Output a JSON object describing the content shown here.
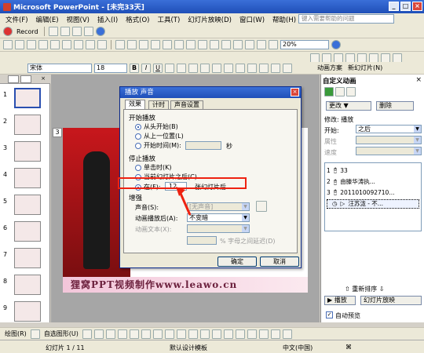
{
  "window": {
    "title": "Microsoft PowerPoint - [未完33天]"
  },
  "menu": {
    "items": [
      "文件(F)",
      "编辑(E)",
      "视图(V)",
      "插入(I)",
      "格式(O)",
      "工具(T)",
      "幻灯片放映(D)",
      "窗口(W)",
      "帮助(H)"
    ],
    "help_placeholder": "键入需要帮助的问题"
  },
  "toolbar1": {
    "record_label": "Record"
  },
  "toolbar2": {
    "zoom": "20%"
  },
  "toolbar3": {
    "font_name": "宋体",
    "font_size": "18",
    "animation_label": "动画方案",
    "new_slide_label": "新幻灯片(N)"
  },
  "dialog": {
    "title": "播放 声音",
    "tabs": [
      "效果",
      "计时",
      "声音设置"
    ],
    "start_group": "开始播放",
    "start_options": [
      "从头开始(B)",
      "从上一位置(L)",
      "开始时间(M):"
    ],
    "start_unit": "秒",
    "stop_group": "停止播放",
    "stop_options": [
      "单击时(K)",
      "当前幻灯片之后(C)",
      "在(F):"
    ],
    "stop_after_value": "12",
    "stop_after_unit": "张幻灯片后",
    "enhance_group": "增强",
    "sound_label": "声音(S):",
    "sound_value": "[无声音]",
    "after_anim_label": "动画播放后(A):",
    "after_anim_value": "不变暗",
    "anim_text_label": "动画文本(X):",
    "letter_delay_label": "% 字母之间延迟(D)",
    "ok_label": "确定",
    "cancel_label": "取消"
  },
  "slide": {
    "number": "3",
    "banner": "狸窝PPT视频制作www.leawo.cn"
  },
  "taskpane": {
    "title": "自定义动画",
    "change_label": "更改",
    "delete_label": "删除",
    "modify_label": "修改: 播放",
    "start_label": "开始:",
    "start_value": "之后",
    "property_label": "属性",
    "speed_label": "速度",
    "list": [
      {
        "num": "1",
        "text": "33"
      },
      {
        "num": "2",
        "text": "由滕华涛执..."
      },
      {
        "num": "3",
        "text": "2011010092710..."
      },
      {
        "num": "",
        "text": "汪苏泷 - 不..."
      }
    ],
    "reorder_label": "重新排序",
    "play_label": "播放",
    "slideshow_label": "幻灯片放映",
    "autopreview_label": "自动预览"
  },
  "draw_toolbar": {
    "draw_label": "绘图(R)",
    "autoshape_label": "自选图形(U)"
  },
  "status": {
    "slide_info": "幻灯片 1 / 11",
    "template": "默认设计模板",
    "language": "中文(中国)"
  },
  "colors": {
    "title_blue": "#1f4fb8",
    "highlight_red": "#e21111",
    "slide_red": "#c8171c"
  }
}
